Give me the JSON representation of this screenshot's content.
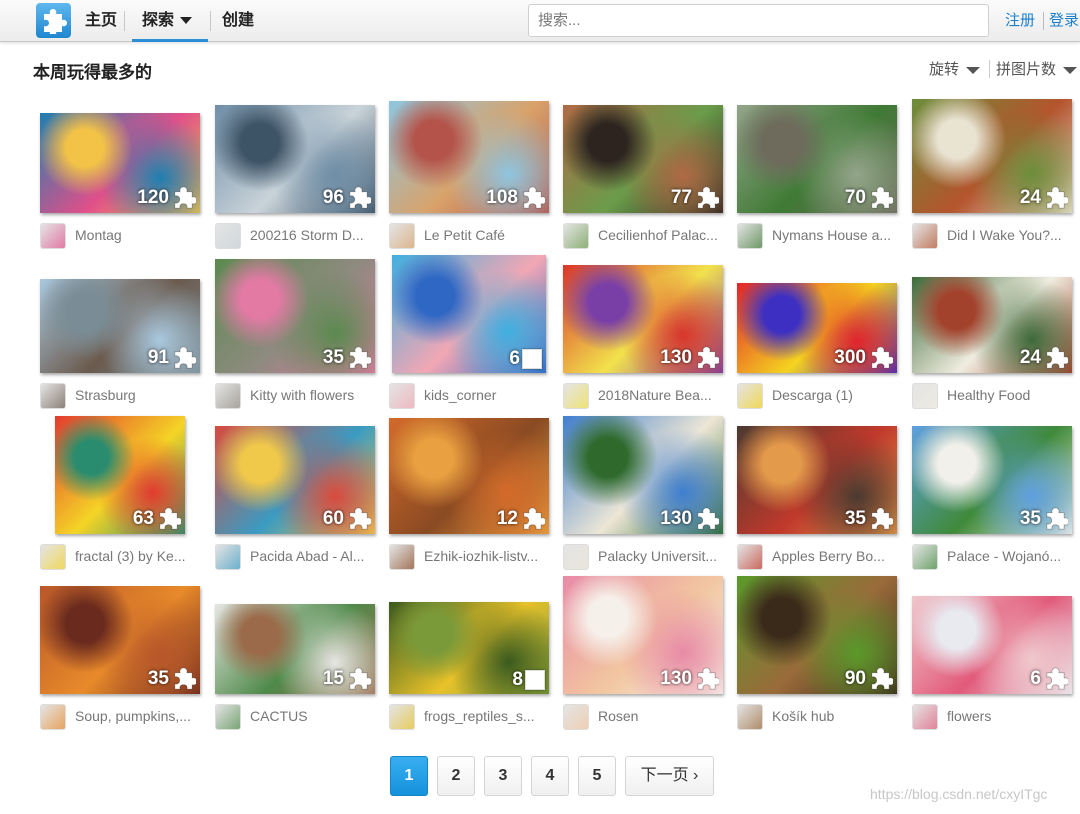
{
  "nav": {
    "home": "主页",
    "explore": "探索",
    "create": "创建",
    "search_placeholder": "搜索...",
    "register": "注册",
    "login": "登录"
  },
  "section": {
    "title": "本周玩得最多的",
    "filter_rotate": "旋转",
    "filter_pieces": "拼图片数"
  },
  "puzzles": [
    {
      "title": "Montag",
      "pieces": "120",
      "icon": "puzzle-piece-icon",
      "colors": [
        "#1e7fb0",
        "#e0508a",
        "#f2c347"
      ]
    },
    {
      "title": "200216 Storm D...",
      "pieces": "96",
      "icon": "puzzle-piece-icon",
      "colors": [
        "#6f8ea7",
        "#c9d3d9",
        "#3d5366"
      ]
    },
    {
      "title": "Le Petit Café",
      "pieces": "108",
      "icon": "puzzle-piece-icon",
      "colors": [
        "#8ec6e0",
        "#d9a26a",
        "#b4534a"
      ]
    },
    {
      "title": "Cecilienhof Palac...",
      "pieces": "77",
      "icon": "puzzle-piece-icon",
      "colors": [
        "#b06a45",
        "#6a9c4a",
        "#2d2420"
      ]
    },
    {
      "title": "Nymans House a...",
      "pieces": "70",
      "icon": "puzzle-piece-icon",
      "colors": [
        "#94a58a",
        "#3f7a35",
        "#6e6a5c"
      ]
    },
    {
      "title": "Did I Wake You?...",
      "pieces": "24",
      "icon": "puzzle-piece-icon",
      "colors": [
        "#6b8e3a",
        "#b4542d",
        "#e9e3d2"
      ]
    },
    {
      "title": "Strasburg",
      "pieces": "91",
      "icon": "puzzle-piece-icon",
      "colors": [
        "#a9c8de",
        "#6b5a4d",
        "#7a8d96"
      ]
    },
    {
      "title": "Kitty with flowers",
      "pieces": "35",
      "icon": "puzzle-piece-icon",
      "colors": [
        "#5a8a4f",
        "#8f8a80",
        "#e27aa4"
      ]
    },
    {
      "title": "kids_corner",
      "pieces": "6",
      "icon": "square-icon",
      "colors": [
        "#3fb0e0",
        "#f2a7b4",
        "#2f67c4"
      ]
    },
    {
      "title": "2018Nature Bea...",
      "pieces": "130",
      "icon": "puzzle-piece-icon",
      "colors": [
        "#d9352b",
        "#f2e24c",
        "#7a3fa6"
      ]
    },
    {
      "title": "Descarga (1)",
      "pieces": "300",
      "icon": "puzzle-piece-icon",
      "colors": [
        "#e0242c",
        "#f5d31f",
        "#3d2fc2"
      ]
    },
    {
      "title": "Healthy Food",
      "pieces": "24",
      "icon": "puzzle-piece-icon",
      "colors": [
        "#3d6a3a",
        "#f0ede0",
        "#a3422c"
      ]
    },
    {
      "title": "fractal (3) by Ke...",
      "pieces": "63",
      "icon": "puzzle-piece-icon",
      "colors": [
        "#e23b2f",
        "#f5d426",
        "#2a8c6e"
      ]
    },
    {
      "title": "Pacida Abad - Al...",
      "pieces": "60",
      "icon": "puzzle-piece-icon",
      "colors": [
        "#d94a3e",
        "#3a9bc2",
        "#f0c84a"
      ]
    },
    {
      "title": "Ezhik-iozhik-listv...",
      "pieces": "12",
      "icon": "puzzle-piece-icon",
      "colors": [
        "#d36a2a",
        "#8a4a22",
        "#e8a040"
      ]
    },
    {
      "title": "Palacky Universit...",
      "pieces": "130",
      "icon": "puzzle-piece-icon",
      "colors": [
        "#3f7ed0",
        "#ece6d6",
        "#2f6a2c"
      ]
    },
    {
      "title": "Apples Berry Bo...",
      "pieces": "35",
      "icon": "puzzle-piece-icon",
      "colors": [
        "#4a3a30",
        "#c0392b",
        "#e39a4a"
      ]
    },
    {
      "title": "Palace - Wojanó...",
      "pieces": "35",
      "icon": "puzzle-piece-icon",
      "colors": [
        "#5fa0e0",
        "#3f8a3a",
        "#f2f0ea"
      ]
    },
    {
      "title": "Soup, pumpkins,...",
      "pieces": "35",
      "icon": "puzzle-piece-icon",
      "colors": [
        "#b8572a",
        "#e88a2a",
        "#6a2a1e"
      ]
    },
    {
      "title": "CACTUS",
      "pieces": "15",
      "icon": "puzzle-piece-icon",
      "colors": [
        "#e6e6e2",
        "#4f8a4a",
        "#9a6a4a"
      ]
    },
    {
      "title": "frogs_reptiles_s...",
      "pieces": "8",
      "icon": "square-icon",
      "colors": [
        "#3a5a1e",
        "#e8c22a",
        "#7a9a3a"
      ]
    },
    {
      "title": "Rosen",
      "pieces": "130",
      "icon": "puzzle-piece-icon",
      "colors": [
        "#e88aa6",
        "#f2c6a0",
        "#f6f0ea"
      ]
    },
    {
      "title": "Košík hub",
      "pieces": "90",
      "icon": "puzzle-piece-icon",
      "colors": [
        "#5a9a2a",
        "#9a6a3a",
        "#3a2a1a"
      ]
    },
    {
      "title": "flowers",
      "pieces": "6",
      "icon": "puzzle-piece-icon",
      "colors": [
        "#f0c8cc",
        "#e25a7a",
        "#e8eaf0"
      ]
    }
  ],
  "pagination": {
    "pages": [
      "1",
      "2",
      "3",
      "4",
      "5"
    ],
    "current": "1",
    "next": "下一页"
  },
  "watermark": "https://blog.csdn.net/cxyITgc"
}
